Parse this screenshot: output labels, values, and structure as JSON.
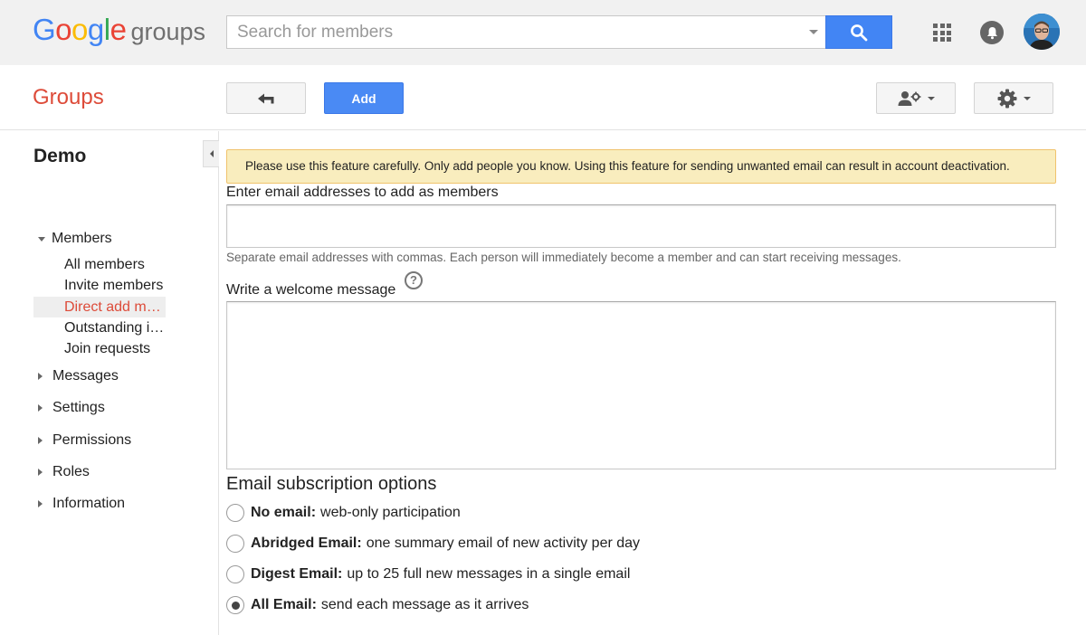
{
  "header": {
    "logo_google": "Google",
    "logo_groups": "groups",
    "search_placeholder": "Search for members",
    "icons": {
      "search": "search-icon",
      "apps": "apps-grid-icon",
      "notifications": "notifications-bell-icon",
      "avatar": "user-avatar"
    }
  },
  "toolbar": {
    "section_title": "Groups",
    "add_label": "Add",
    "icons": {
      "back": "back-arrow-icon",
      "people_settings": "people-settings-icon",
      "gear": "gear-icon"
    }
  },
  "sidebar": {
    "group_name": "Demo",
    "members_section": {
      "label": "Members",
      "expanded": true,
      "items": [
        {
          "label": "All members",
          "active": false
        },
        {
          "label": "Invite members",
          "active": false
        },
        {
          "label": "Direct add m…",
          "active": true
        },
        {
          "label": "Outstanding i…",
          "active": false
        },
        {
          "label": "Join requests",
          "active": false
        }
      ]
    },
    "sections": [
      {
        "label": "Messages"
      },
      {
        "label": "Settings"
      },
      {
        "label": "Permissions"
      },
      {
        "label": "Roles"
      },
      {
        "label": "Information"
      }
    ]
  },
  "main": {
    "alert": "Please use this feature carefully. Only add people you know. Using this feature for sending unwanted email can result in account deactivation.",
    "emails_label": "Enter email addresses to add as members",
    "emails_value": "",
    "emails_hint": "Separate email addresses with commas. Each person will immediately become a member and can start receiving messages.",
    "welcome_label": "Write a welcome message",
    "welcome_help": "?",
    "welcome_value": "",
    "subscription_title": "Email subscription options",
    "subscription_options": [
      {
        "name": "No email:",
        "desc": "web-only participation",
        "checked": false
      },
      {
        "name": "Abridged Email:",
        "desc": "one summary email of new activity per day",
        "checked": false
      },
      {
        "name": "Digest Email:",
        "desc": "up to 25 full new messages in a single email",
        "checked": false
      },
      {
        "name": "All Email:",
        "desc": "send each message as it arrives",
        "checked": true
      }
    ]
  },
  "colors": {
    "google_blue": "#4285f4",
    "google_red": "#ea4335",
    "google_yellow": "#fbbc05",
    "google_green": "#34a853",
    "groups_red": "#dd4b39",
    "primary_button": "#4a8af4",
    "alert_bg": "#f9edbe",
    "alert_border": "#f0c36d"
  }
}
